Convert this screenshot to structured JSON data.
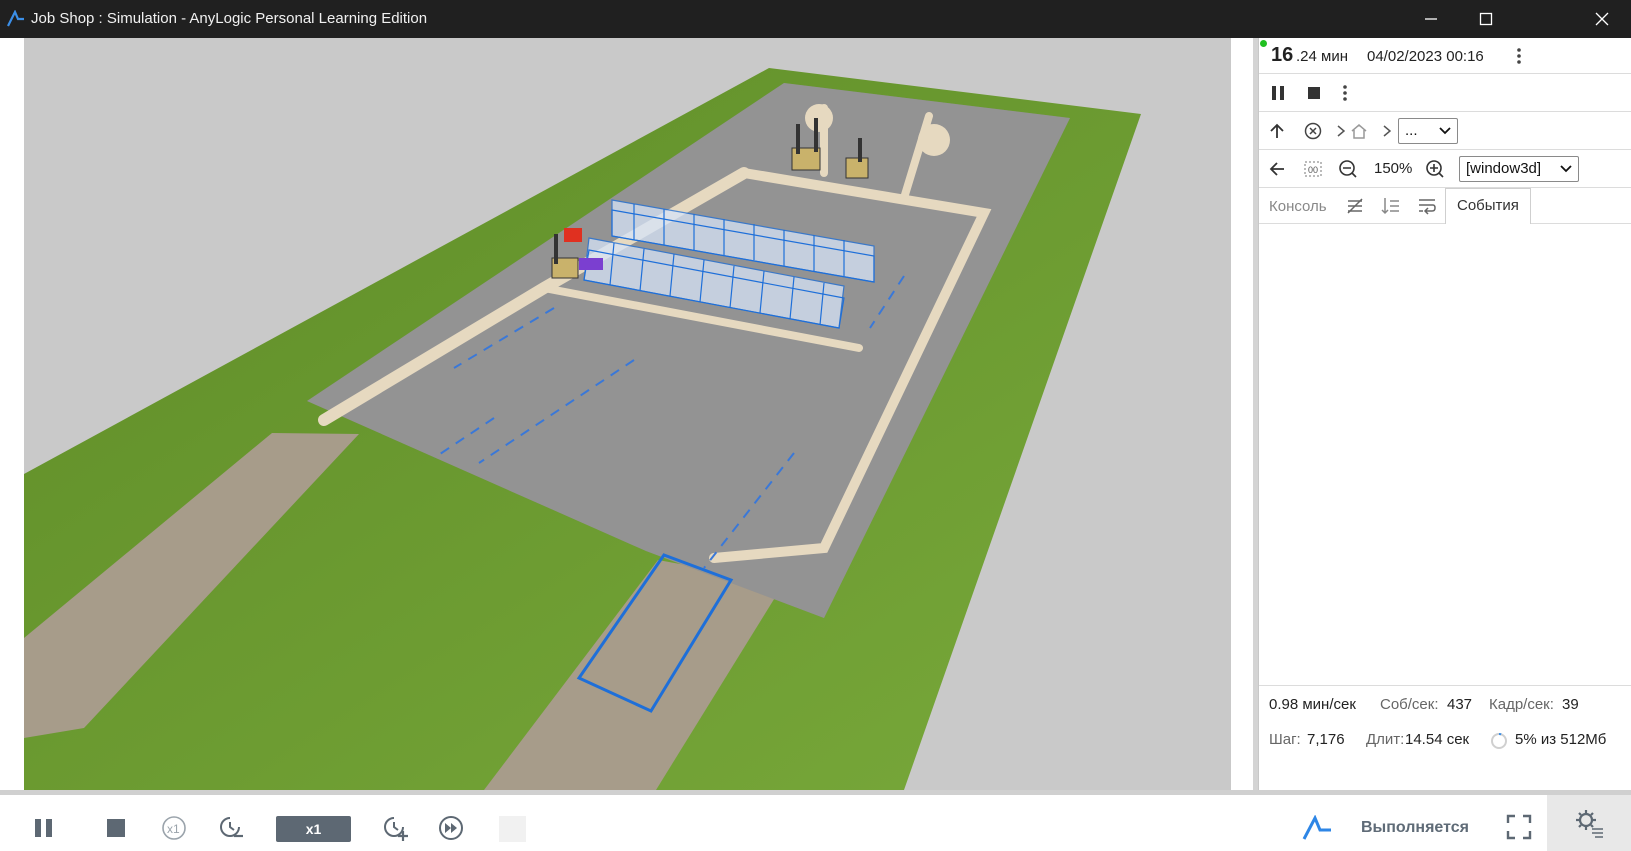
{
  "window": {
    "title": "Job Shop : Simulation - AnyLogic Personal Learning Edition",
    "minimize_icon": "minimize-icon",
    "maximize_icon": "maximize-icon",
    "close_icon": "close-icon"
  },
  "panel": {
    "time_main": "16",
    "time_frac": ".24 мин",
    "datetime": "04/02/2023 00:16",
    "zoom": "150%",
    "nav_select": "...",
    "view_select": "[window3d]",
    "tab_console": "Консоль",
    "tab_events": "События",
    "stats": {
      "speed": "0.98 мин/сек",
      "events_label": "Соб/сек:",
      "events_value": "437",
      "frames_label": "Кадр/сек:",
      "frames_value": "39",
      "step_label": "Шаг:",
      "step_value": "7,176",
      "duration_label": "Длит:",
      "duration_value": "14.54 сек",
      "memory": "5% из 512Мб"
    }
  },
  "toolbar": {
    "speed_label": "x1",
    "x1_label": "x1",
    "status": "Выполняется"
  },
  "colors": {
    "titlebar": "#202020",
    "accent_blue": "#1e6fd9",
    "grass": "#6c9a2e",
    "concrete": "#8f8f8f",
    "road": "#e6d9c0",
    "status_gray": "#5f6b77"
  }
}
